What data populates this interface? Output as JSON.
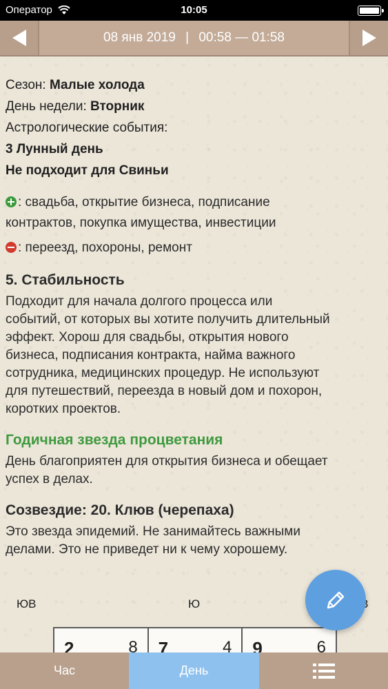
{
  "status_bar": {
    "carrier": "Оператор",
    "time": "10:05"
  },
  "nav": {
    "date": "08 янв 2019",
    "separator": "|",
    "time_range": "00:58 — 01:58"
  },
  "info": {
    "season_label": "Сезон:",
    "season_value": "Малые холода",
    "weekday_label": "День недели:",
    "weekday_value": "Вторник",
    "astro_label": "Астрологические события:",
    "lunar_day": "3 Лунный день",
    "not_suitable": "Не подходит для Свиньи"
  },
  "good": {
    "text_line1": ": свадьба, открытие бизнеса, подписание",
    "text_line2": "контрактов, покупка имущества, инвестиции"
  },
  "bad": {
    "text": ": переезд, похороны, ремонт"
  },
  "stability": {
    "title": "5. Стабильность",
    "lines": [
      "Подходит для начала долгого процесса или",
      "событий, от которых вы хотите получить длительный",
      "эффект. Хорош для свадьбы, открытия нового",
      "бизнеса, подписания контракта, найма важного",
      "сотрудника, медицинских процедур. Не используют",
      "для путешествий, переезда в новый дом и похорон,",
      "коротких проектов."
    ]
  },
  "star": {
    "title": "Годичная звезда процветания",
    "lines": [
      "День благоприятен для открытия бизнеса и обещает",
      "успех в делах."
    ]
  },
  "constellation": {
    "title": "Созвездие: 20. Клюв (черепаха)",
    "lines": [
      "Это звезда эпидемий. Не занимайтесь важными",
      "делами. Это не приведет ни к чему хорошему."
    ]
  },
  "compass": {
    "se": "ЮВ",
    "s": "Ю",
    "sw": "ЮЗ"
  },
  "grid": [
    {
      "big": "2",
      "small": "8"
    },
    {
      "big": "7",
      "small": "4"
    },
    {
      "big": "9",
      "small": "6"
    }
  ],
  "tabs": {
    "hour": "Час",
    "day": "День"
  },
  "icons": {
    "prev": "arrow-left-icon",
    "next": "arrow-right-icon",
    "edit": "pencil-icon",
    "menu": "list-icon",
    "good": "plus-circle-icon",
    "bad": "minus-circle-icon",
    "wifi": "wifi-icon",
    "battery": "battery-icon"
  },
  "colors": {
    "nav": "#c3ab98",
    "accent_green": "#3f9a3f",
    "fab": "#5e9fe0",
    "tab_active": "#8fc1ef"
  }
}
